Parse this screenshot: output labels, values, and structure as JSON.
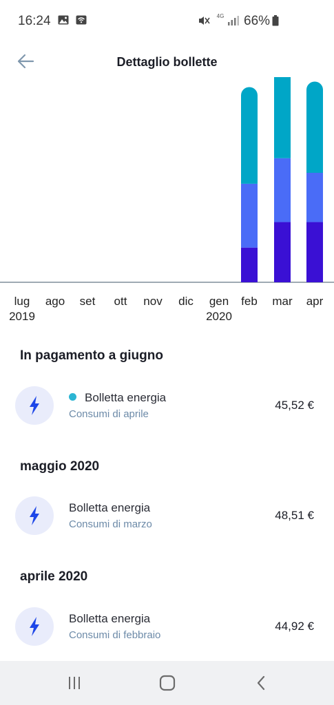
{
  "status_bar": {
    "time": "16:24",
    "network": "4G",
    "battery": "66%"
  },
  "header": {
    "title": "Dettaglio bollette",
    "back_icon": "arrow-left-icon"
  },
  "colors": {
    "segment_top": "#00a6c7",
    "segment_mid": "#4a6cf7",
    "segment_bottom": "#3a10d4",
    "icon_bg": "#e9ecfb",
    "bolt": "#1d46e8",
    "dot": "#2cb5d3",
    "subtext": "#6c8aa8"
  },
  "chart_data": {
    "type": "bar",
    "stacked": true,
    "categories": [
      "lug",
      "ago",
      "set",
      "ott",
      "nov",
      "dic",
      "gen",
      "feb",
      "mar",
      "apr"
    ],
    "year_labels": [
      "2019",
      "",
      "",
      "",
      "",
      "",
      "2020",
      "",
      "",
      ""
    ],
    "series": [
      {
        "values": [
          0,
          0,
          0,
          0,
          0,
          0,
          0,
          9.5,
          16.5,
          16.5
        ]
      },
      {
        "values": [
          0,
          0,
          0,
          0,
          0,
          0,
          0,
          17.5,
          17.5,
          13.5
        ]
      },
      {
        "values": [
          0,
          0,
          0,
          0,
          0,
          0,
          0,
          26.5,
          27.5,
          25
        ]
      }
    ],
    "grid": false
  },
  "sections": [
    {
      "title": "In pagamento a giugno",
      "bills": [
        {
          "title": "Bolletta energia",
          "subtitle": "Consumi di aprile",
          "amount": "45,52 €",
          "dot": true
        }
      ]
    },
    {
      "title": "maggio 2020",
      "bills": [
        {
          "title": "Bolletta energia",
          "subtitle": "Consumi di marzo",
          "amount": "48,51 €",
          "dot": false
        }
      ]
    },
    {
      "title": "aprile 2020",
      "bills": [
        {
          "title": "Bolletta energia",
          "subtitle": "Consumi di febbraio",
          "amount": "44,92 €",
          "dot": false
        }
      ]
    }
  ]
}
